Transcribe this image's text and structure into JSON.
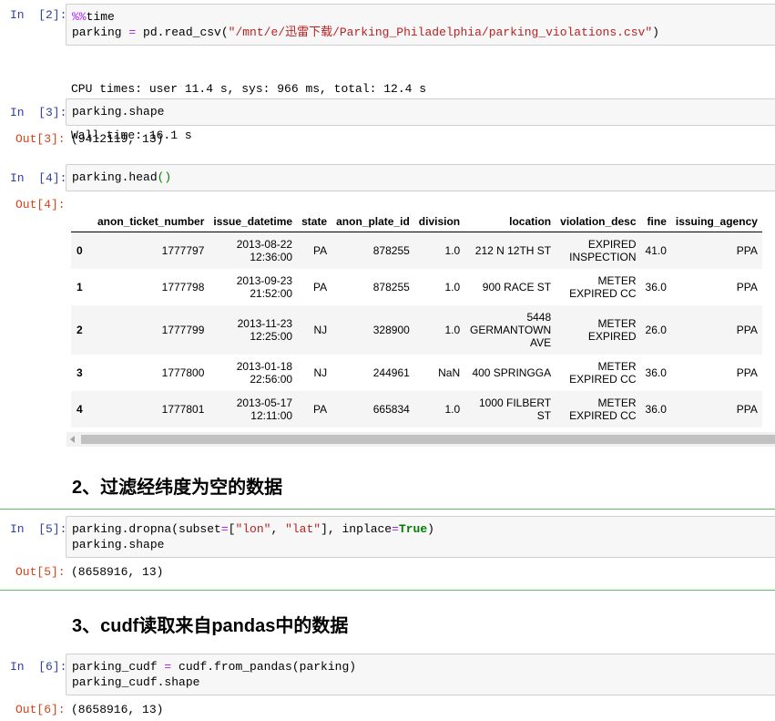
{
  "cells": [
    {
      "in_prompt": "In  [2]:",
      "code_tokens": [
        [
          {
            "t": "%%",
            "c": "op"
          },
          {
            "t": "time",
            "c": ""
          }
        ],
        [
          {
            "t": "parking ",
            "c": ""
          },
          {
            "t": "=",
            "c": "op"
          },
          {
            "t": " pd.read_csv(",
            "c": ""
          },
          {
            "t": "\"/mnt/e/迅雷下载/Parking_Philadelphia/parking_violations.csv\"",
            "c": "str"
          },
          {
            "t": ")",
            "c": ""
          }
        ]
      ],
      "output_lines": [
        "CPU times: user 11.4 s, sys: 966 ms, total: 12.4 s",
        "Wall time: 16.1 s"
      ]
    },
    {
      "in_prompt": "In  [3]:",
      "code_tokens": [
        [
          {
            "t": "parking.shape",
            "c": ""
          }
        ]
      ],
      "out_prompt": "Out[3]:",
      "output": "(9412119, 13)"
    },
    {
      "in_prompt": "In  [4]:",
      "code_tokens": [
        [
          {
            "t": "parking.head",
            "c": ""
          },
          {
            "t": "()",
            "c": "paren"
          }
        ]
      ],
      "out_prompt": "Out[4]:"
    },
    {
      "in_prompt": "In  [5]:",
      "code_tokens": [
        [
          {
            "t": "parking.dropna(subset",
            "c": ""
          },
          {
            "t": "=",
            "c": "op"
          },
          {
            "t": "[",
            "c": ""
          },
          {
            "t": "\"lon\"",
            "c": "str"
          },
          {
            "t": ", ",
            "c": ""
          },
          {
            "t": "\"lat\"",
            "c": "str"
          },
          {
            "t": "], inplace",
            "c": ""
          },
          {
            "t": "=",
            "c": "op"
          },
          {
            "t": "True",
            "c": "bool"
          },
          {
            "t": ")",
            "c": ""
          }
        ],
        [
          {
            "t": "parking.shape",
            "c": ""
          }
        ]
      ],
      "out_prompt": "Out[5]:",
      "output": "(8658916, 13)"
    },
    {
      "in_prompt": "In  [6]:",
      "code_tokens": [
        [
          {
            "t": "parking_cudf ",
            "c": ""
          },
          {
            "t": "=",
            "c": "op"
          },
          {
            "t": " cudf.from_pandas(parking)",
            "c": ""
          }
        ],
        [
          {
            "t": "parking_cudf.shape",
            "c": ""
          }
        ]
      ],
      "out_prompt": "Out[6]:",
      "output": "(8658916, 13)"
    }
  ],
  "headings": {
    "h2": "2、过滤经纬度为空的数据",
    "h3": "3、cudf读取来自pandas中的数据"
  },
  "dataframe": {
    "columns": [
      "",
      "anon_ticket_number",
      "issue_datetime",
      "state",
      "anon_plate_id",
      "division",
      "location",
      "violation_desc",
      "fine",
      "issuing_agency"
    ],
    "rows": [
      [
        "0",
        "1777797",
        "2013-08-22\n12:36:00",
        "PA",
        "878255",
        "1.0",
        "212 N 12TH ST",
        "EXPIRED\nINSPECTION",
        "41.0",
        "PPA"
      ],
      [
        "1",
        "1777798",
        "2013-09-23\n21:52:00",
        "PA",
        "878255",
        "1.0",
        "900 RACE ST",
        "METER\nEXPIRED CC",
        "36.0",
        "PPA"
      ],
      [
        "2",
        "1777799",
        "2013-11-23\n12:25:00",
        "NJ",
        "328900",
        "1.0",
        "5448\nGERMANTOWN\nAVE",
        "METER\nEXPIRED",
        "26.0",
        "PPA"
      ],
      [
        "3",
        "1777800",
        "2013-01-18\n22:56:00",
        "NJ",
        "244961",
        "NaN",
        "400 SPRINGGA",
        "METER\nEXPIRED CC",
        "36.0",
        "PPA"
      ],
      [
        "4",
        "1777801",
        "2013-05-17\n12:11:00",
        "PA",
        "665834",
        "1.0",
        "1000 FILBERT\nST",
        "METER\nEXPIRED CC",
        "36.0",
        "PPA"
      ]
    ]
  },
  "colors": {
    "in_prompt": "#303F9F",
    "out_prompt": "#D84315",
    "selection_bar": "#42A5F5",
    "selection_border": "#66BB6A"
  }
}
